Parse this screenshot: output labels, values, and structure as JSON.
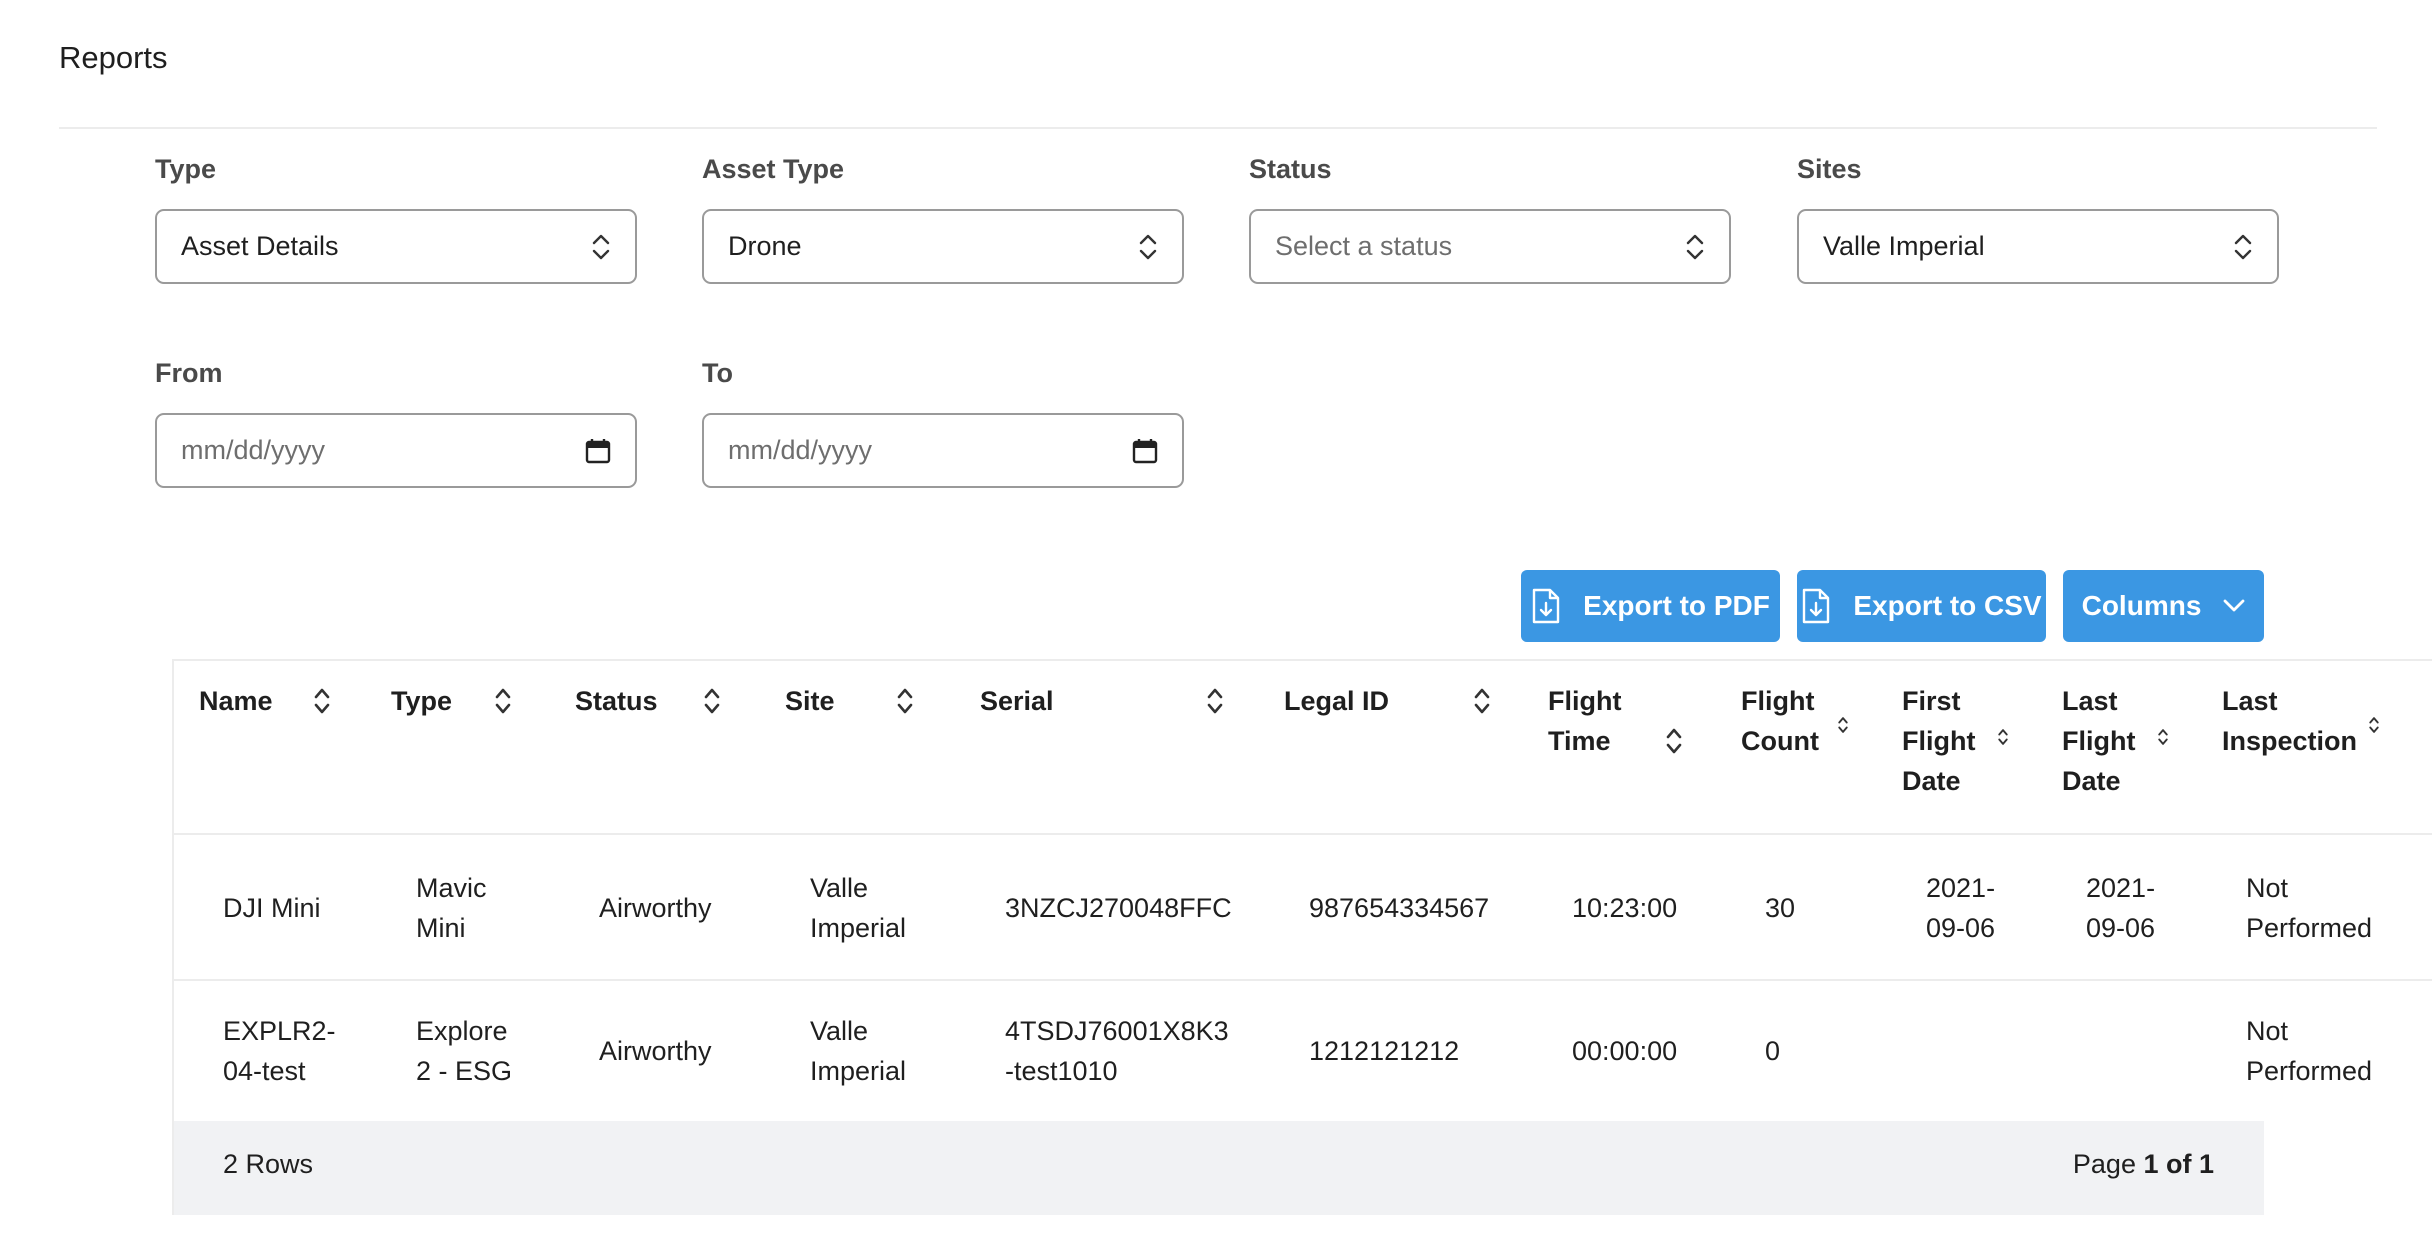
{
  "page": {
    "title": "Reports"
  },
  "filters": {
    "type": {
      "label": "Type",
      "value": "Asset Details"
    },
    "asset_type": {
      "label": "Asset Type",
      "value": "Drone"
    },
    "status": {
      "label": "Status",
      "placeholder": "Select a status"
    },
    "sites": {
      "label": "Sites",
      "value": "Valle Imperial"
    },
    "from": {
      "label": "From",
      "placeholder": "mm/dd/yyyy"
    },
    "to": {
      "label": "To",
      "placeholder": "mm/dd/yyyy"
    }
  },
  "toolbar": {
    "export_pdf": "Export to PDF",
    "export_csv": "Export to CSV",
    "columns": "Columns"
  },
  "table": {
    "headers": {
      "name": "Name",
      "type": "Type",
      "status": "Status",
      "site": "Site",
      "serial": "Serial",
      "legal_id": "Legal ID",
      "flight_time": [
        "Flight",
        "Time"
      ],
      "flight_count": [
        "Flight",
        "Count"
      ],
      "first_flight_date": [
        "First",
        "Flight",
        "Date"
      ],
      "last_flight_date": [
        "Last",
        "Flight",
        "Date"
      ],
      "last_inspection": [
        "Last",
        "Inspection"
      ]
    },
    "rows": [
      {
        "name": [
          "DJI Mini"
        ],
        "type": [
          "Mavic",
          "Mini"
        ],
        "status": [
          "Airworthy"
        ],
        "site": [
          "Valle",
          "Imperial"
        ],
        "serial": [
          "3NZCJ270048FFC"
        ],
        "legal_id": [
          "987654334567"
        ],
        "flight_time": [
          "10:23:00"
        ],
        "flight_count": [
          "30"
        ],
        "first_flight_date": [
          "2021-",
          "09-06"
        ],
        "last_flight_date": [
          "2021-",
          "09-06"
        ],
        "last_inspection": [
          "Not",
          "Performed"
        ]
      },
      {
        "name": [
          "EXPLR2-",
          "04-test"
        ],
        "type": [
          "Explore",
          "2 - ESG"
        ],
        "status": [
          "Airworthy"
        ],
        "site": [
          "Valle",
          "Imperial"
        ],
        "serial": [
          "4TSDJ76001X8K3",
          "-test1010"
        ],
        "legal_id": [
          "1212121212"
        ],
        "flight_time": [
          "00:00:00"
        ],
        "flight_count": [
          "0"
        ],
        "first_flight_date": [],
        "last_flight_date": [],
        "last_inspection": [
          "Not",
          "Performed"
        ]
      }
    ],
    "footer": {
      "rows_label": "2 Rows",
      "page_prefix": "Page",
      "page_value": "1 of 1"
    }
  },
  "colors": {
    "accent": "#3b97e3",
    "border": "#9a9a9a",
    "footer_bg": "#f1f2f4"
  },
  "icons": {
    "select": "up-down-chevron-icon",
    "date": "calendar-icon",
    "export": "file-download-icon",
    "columns": "chevron-down-icon",
    "sort": "sort-icon"
  }
}
